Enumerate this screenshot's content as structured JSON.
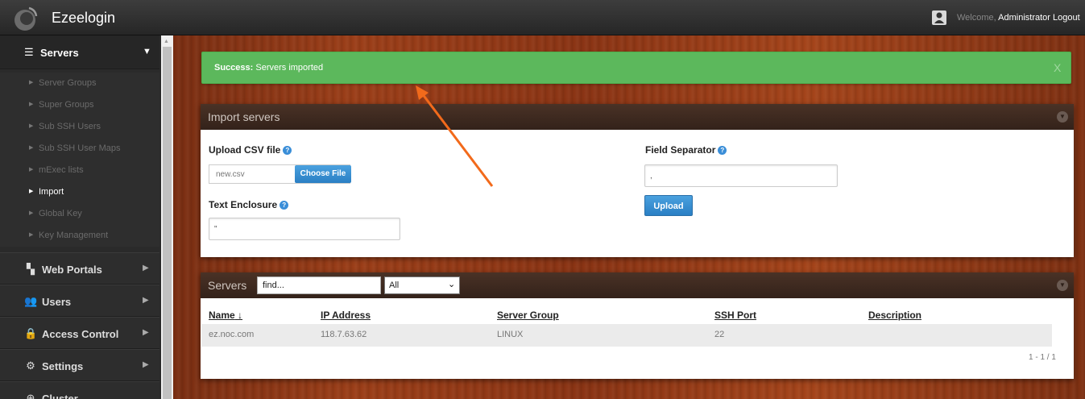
{
  "header": {
    "brand": "Ezeelogin",
    "welcome_prefix": "Welcome,",
    "user_name": "Administrator",
    "logout_label": "Logout"
  },
  "sidebar": {
    "section": {
      "label": "Servers",
      "icon": "list-icon"
    },
    "subitems": [
      {
        "label": "Server Groups",
        "active": false
      },
      {
        "label": "Super Groups",
        "active": false
      },
      {
        "label": "Sub SSH Users",
        "active": false
      },
      {
        "label": "Sub SSH User Maps",
        "active": false
      },
      {
        "label": "mExec lists",
        "active": false
      },
      {
        "label": "Import",
        "active": true
      },
      {
        "label": "Global Key",
        "active": false
      },
      {
        "label": "Key Management",
        "active": false
      }
    ],
    "groups": [
      {
        "label": "Web Portals",
        "icon": "web-portals-icon"
      },
      {
        "label": "Users",
        "icon": "users-icon"
      },
      {
        "label": "Access Control",
        "icon": "lock-icon"
      },
      {
        "label": "Settings",
        "icon": "gears-icon"
      },
      {
        "label": "Cluster",
        "icon": "cluster-icon"
      }
    ]
  },
  "alert": {
    "strong": "Success:",
    "message": "Servers imported",
    "close": "X"
  },
  "import_panel": {
    "title": "Import servers",
    "upload_label": "Upload CSV file",
    "file_name": "new.csv",
    "choose_file": "Choose File",
    "text_enclosure_label": "Text Enclosure",
    "text_enclosure_value": "\"",
    "field_separator_label": "Field Separator",
    "field_separator_value": ",",
    "upload_button": "Upload"
  },
  "servers_panel": {
    "title": "Servers",
    "find_value": "find...",
    "filter_selected": "All",
    "columns": [
      "Name",
      "IP Address",
      "Server Group",
      "SSH Port",
      "Description"
    ],
    "sort_indicator": "↓",
    "rows": [
      {
        "name": "ez.noc.com",
        "ip": "118.7.63.62",
        "group": "LINUX",
        "port": "22",
        "description": ""
      }
    ],
    "pagination": "1 - 1 / 1"
  },
  "colors": {
    "success": "#5cb85c",
    "primary_button": "#2a7fc4",
    "annotation_arrow": "#f26a1b"
  }
}
